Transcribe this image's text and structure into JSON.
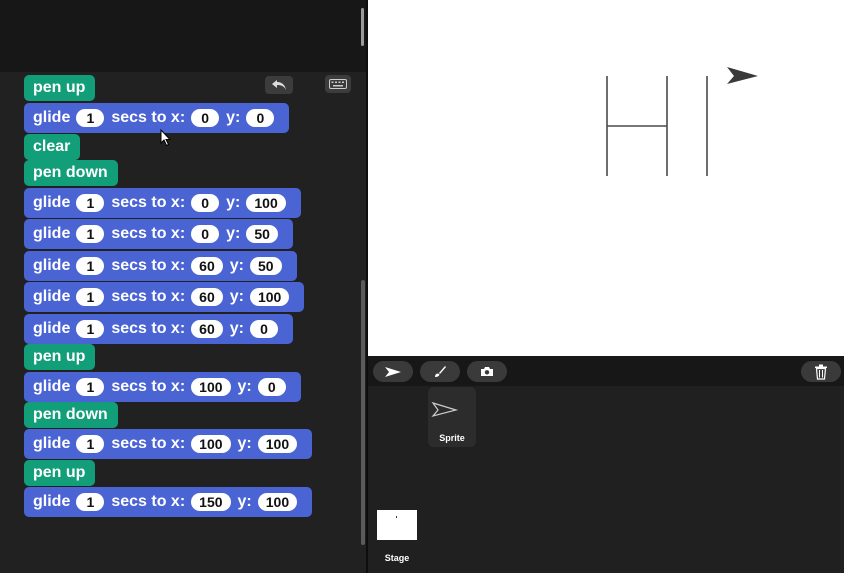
{
  "colors": {
    "pen_block": "#139e7a",
    "motion_block": "#4a64d4",
    "stage_bg": "#ffffff",
    "ide_bg": "#212121"
  },
  "toolbar": {
    "undo_icon": "undo-arrow-icon",
    "keyboard_icon": "keyboard-icon"
  },
  "script": [
    {
      "type": "pen",
      "label": "pen up"
    },
    {
      "type": "glide",
      "secs": "1",
      "x": "0",
      "y": "0"
    },
    {
      "type": "pen",
      "label": "clear"
    },
    {
      "type": "pen",
      "label": "pen down"
    },
    {
      "type": "glide",
      "secs": "1",
      "x": "0",
      "y": "100"
    },
    {
      "type": "glide",
      "secs": "1",
      "x": "0",
      "y": "50"
    },
    {
      "type": "glide",
      "secs": "1",
      "x": "60",
      "y": "50"
    },
    {
      "type": "glide",
      "secs": "1",
      "x": "60",
      "y": "100"
    },
    {
      "type": "glide",
      "secs": "1",
      "x": "60",
      "y": "0"
    },
    {
      "type": "pen",
      "label": "pen up"
    },
    {
      "type": "glide",
      "secs": "1",
      "x": "100",
      "y": "0"
    },
    {
      "type": "pen",
      "label": "pen down"
    },
    {
      "type": "glide",
      "secs": "1",
      "x": "100",
      "y": "100"
    },
    {
      "type": "pen",
      "label": "pen up"
    },
    {
      "type": "glide",
      "secs": "1",
      "x": "150",
      "y": "100"
    }
  ],
  "glide_words": {
    "glide": "glide",
    "secs_to_x": "secs to x:",
    "y": "y:"
  },
  "corral": {
    "tools": [
      "arrow-icon",
      "paintbrush-icon",
      "camera-icon"
    ],
    "trash_icon": "trash-icon",
    "sprite_label": "Sprite",
    "stage_label": "Stage"
  }
}
